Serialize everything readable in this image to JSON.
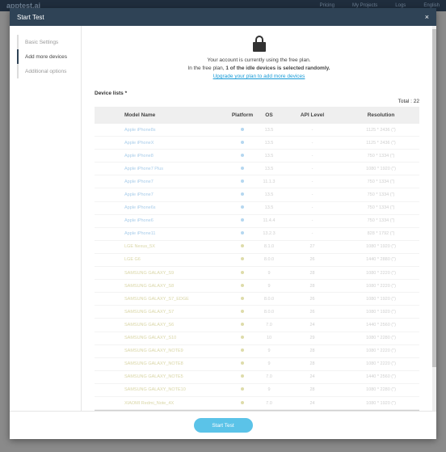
{
  "background": {
    "logo": "apptest.ai",
    "nav": [
      "Pricing",
      "My Projects",
      "Logs",
      "English"
    ]
  },
  "modal": {
    "title": "Start Test",
    "close_glyph": "×"
  },
  "sidebar": {
    "items": [
      {
        "label": "Basic Settings"
      },
      {
        "label": "Add more devices"
      },
      {
        "label": "Additional options"
      }
    ]
  },
  "plan": {
    "line1": "Your account is currently using the free plan.",
    "line2_prefix": "In the free plan,",
    "line2_bold": "1 of the idle devices is selected randomly.",
    "upgrade_link": "Upgrade your plan to add more devices"
  },
  "devices": {
    "title": "Device lists *",
    "total": "Total : 22",
    "columns": [
      "Model Name",
      "Platform",
      "OS",
      "API Level",
      "Resolution"
    ],
    "rows": [
      {
        "model": "Apple iPhone8s",
        "platform": "ios",
        "os": "13.5",
        "api": "-",
        "res": "1125 * 2436 (\")"
      },
      {
        "model": "Apple iPhoneX",
        "platform": "ios",
        "os": "13.5",
        "api": "-",
        "res": "1125 * 2436 (\")"
      },
      {
        "model": "Apple iPhone8",
        "platform": "ios",
        "os": "13.5",
        "api": "-",
        "res": "750 * 1334 (\")"
      },
      {
        "model": "Apple iPhone7 Plus",
        "platform": "ios",
        "os": "13.5",
        "api": "-",
        "res": "1080 * 1920 (\")"
      },
      {
        "model": "Apple iPhone7",
        "platform": "ios",
        "os": "11.1.3",
        "api": "-",
        "res": "750 * 1334 (\")"
      },
      {
        "model": "Apple iPhone7",
        "platform": "ios",
        "os": "13.5",
        "api": "-",
        "res": "750 * 1334 (\")"
      },
      {
        "model": "Apple iPhone6s",
        "platform": "ios",
        "os": "13.5",
        "api": "-",
        "res": "750 * 1334 (\")"
      },
      {
        "model": "Apple iPhone6",
        "platform": "ios",
        "os": "11.4.4",
        "api": "-",
        "res": "750 * 1334 (\")"
      },
      {
        "model": "Apple iPhone11",
        "platform": "ios",
        "os": "13.2.3",
        "api": "-",
        "res": "828 * 1792 (\")"
      },
      {
        "model": "LGE Nexus_5X",
        "platform": "android",
        "os": "8.1.0",
        "api": "27",
        "res": "1080 * 1920 (\")"
      },
      {
        "model": "LGE G6",
        "platform": "android",
        "os": "8.0.0",
        "api": "26",
        "res": "1440 * 2880 (\")"
      },
      {
        "model": "SAMSUNG GALAXY_S9",
        "platform": "android",
        "os": "9",
        "api": "28",
        "res": "1080 * 2220 (\")"
      },
      {
        "model": "SAMSUNG GALAXY_S8",
        "platform": "android",
        "os": "9",
        "api": "28",
        "res": "1080 * 2220 (\")"
      },
      {
        "model": "SAMSUNG GALAXY_S7_EDGE",
        "platform": "android",
        "os": "8.0.0",
        "api": "26",
        "res": "1080 * 1920 (\")"
      },
      {
        "model": "SAMSUNG GALAXY_S7",
        "platform": "android",
        "os": "8.0.0",
        "api": "26",
        "res": "1080 * 1920 (\")"
      },
      {
        "model": "SAMSUNG GALAXY_S6",
        "platform": "android",
        "os": "7.0",
        "api": "24",
        "res": "1440 * 2560 (\")"
      },
      {
        "model": "SAMSUNG GALAXY_S10",
        "platform": "android",
        "os": "10",
        "api": "29",
        "res": "1080 * 2280 (\")"
      },
      {
        "model": "SAMSUNG GALAXY_NOTE9",
        "platform": "android",
        "os": "9",
        "api": "28",
        "res": "1080 * 2220 (\")"
      },
      {
        "model": "SAMSUNG GALAXY_NOTE8",
        "platform": "android",
        "os": "9",
        "api": "28",
        "res": "1080 * 2220 (\")"
      },
      {
        "model": "SAMSUNG GALAXY_NOTE5",
        "platform": "android",
        "os": "7.0",
        "api": "24",
        "res": "1440 * 2560 (\")"
      },
      {
        "model": "SAMSUNG GALAXY_NOTE10",
        "platform": "android",
        "os": "9",
        "api": "28",
        "res": "1080 * 2280 (\")"
      },
      {
        "model": "XIAOMI Redmi_Note_4X",
        "platform": "android",
        "os": "7.0",
        "api": "24",
        "res": "1080 * 1920 (\")"
      }
    ]
  },
  "footer": {
    "start_label": "Start Test"
  },
  "colors": {
    "header": "#2f4356",
    "accent": "#5bc3e8",
    "link": "#1a9bd7"
  }
}
